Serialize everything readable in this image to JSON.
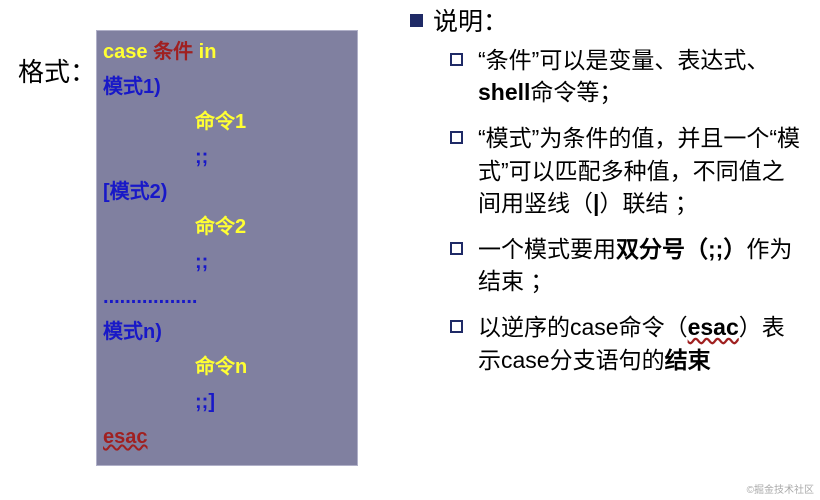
{
  "left": {
    "label": "格式：",
    "code": {
      "l1_case": "case",
      "l1_cond": " 条件 ",
      "l1_in": "in",
      "l2": "模式1)",
      "l3": "命令1",
      "l4": ";;",
      "l5": "[模式2)",
      "l6": "命令2",
      "l7": ";;",
      "l8": ".................",
      "l9": "模式n)",
      "l10": "命令n",
      "l11": ";;]",
      "l12": "esac"
    }
  },
  "right": {
    "heading": "说明：",
    "items": [
      {
        "pre": "“条件”可以是变量、表达式、",
        "bold": "shell",
        "post": "命令等；"
      },
      {
        "pre": "“模式”为条件的值，并且一个“模式”可以匹配多种值，不同值之间用竖线（",
        "bold": "|",
        "post": "）联结 ；"
      },
      {
        "pre": "一个模式要用",
        "bold": "双分号（;;）",
        "post": "作为结束 ；"
      },
      {
        "pre": "以逆序的case命令（",
        "bold_uw": "esac",
        "post2": "）表示case分支语句的",
        "bold2": "结束"
      }
    ]
  },
  "watermark": "©掘金技术社区"
}
